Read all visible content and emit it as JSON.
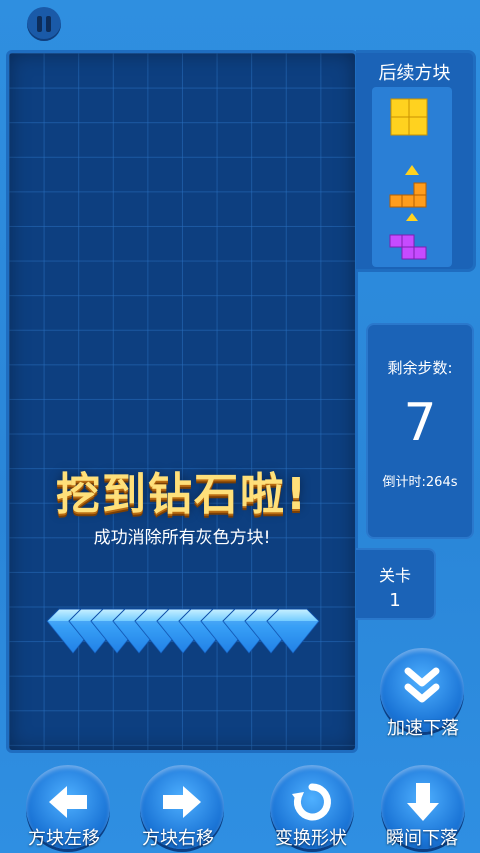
{
  "next_panel": {
    "title": "后续方块"
  },
  "banner": {
    "title": "挖到钻石啦!",
    "subtitle": "成功消除所有灰色方块!"
  },
  "stats": {
    "steps_label": "剩余步数:",
    "steps_value": "7",
    "timer": "倒计时:264s"
  },
  "level": {
    "label": "关卡",
    "value": "1"
  },
  "controls": {
    "speed_down": "加速下落",
    "move_left": "方块左移",
    "move_right": "方块右移",
    "rotate": "变换形状",
    "hard_drop": "瞬间下落"
  },
  "colors": {
    "next_block_1": "#ffd21f",
    "next_block_2": "#ff9d1c",
    "next_block_3": "#c64bff",
    "board": "#0d3f80",
    "gem": "#3aaeff"
  }
}
